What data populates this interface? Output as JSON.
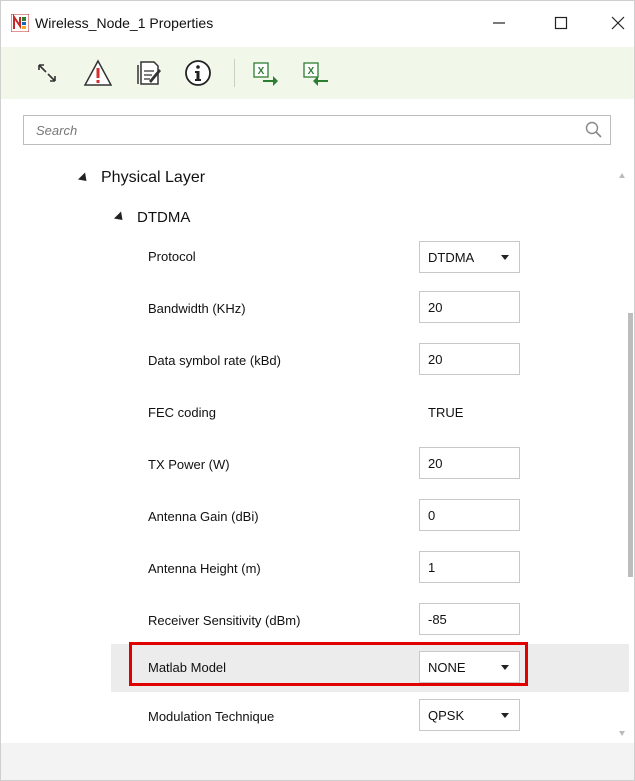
{
  "window": {
    "title": "Wireless_Node_1 Properties",
    "accent_color": "#f1f8e9",
    "highlight_color": "#e00000"
  },
  "toolbar": {
    "buttons": [
      {
        "icon": "expand-collapse-icon"
      },
      {
        "icon": "warning-icon"
      },
      {
        "icon": "edit-document-icon"
      },
      {
        "icon": "info-icon"
      },
      {
        "icon": "excel-export-icon"
      },
      {
        "icon": "excel-import-icon"
      }
    ]
  },
  "search": {
    "placeholder": "Search",
    "value": ""
  },
  "tree": {
    "group": "Physical Layer",
    "subgroup": "DTDMA",
    "properties": [
      {
        "label": "Protocol",
        "value": "DTDMA",
        "kind": "select"
      },
      {
        "label": "Bandwidth (KHz)",
        "value": "20",
        "kind": "input"
      },
      {
        "label": "Data symbol rate (kBd)",
        "value": "20",
        "kind": "input"
      },
      {
        "label": "FEC coding",
        "value": "TRUE",
        "kind": "static"
      },
      {
        "label": "TX Power (W)",
        "value": "20",
        "kind": "input"
      },
      {
        "label": "Antenna Gain (dBi)",
        "value": "0",
        "kind": "input"
      },
      {
        "label": "Antenna Height (m)",
        "value": "1",
        "kind": "input"
      },
      {
        "label": "Receiver Sensitivity (dBm)",
        "value": "-85",
        "kind": "input"
      },
      {
        "label": "Matlab Model",
        "value": "NONE",
        "kind": "select",
        "highlighted": true
      },
      {
        "label": "Modulation Technique",
        "value": "QPSK",
        "kind": "select"
      }
    ]
  }
}
